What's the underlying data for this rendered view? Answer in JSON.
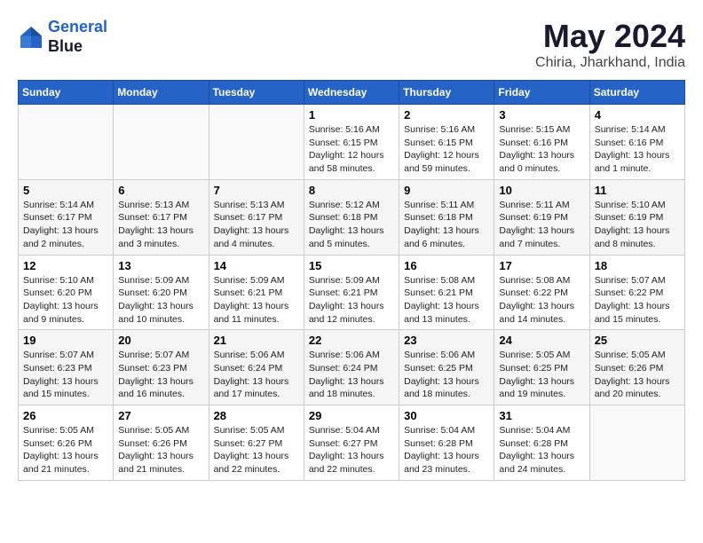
{
  "header": {
    "logo_line1": "General",
    "logo_line2": "Blue",
    "title": "May 2024",
    "subtitle": "Chiria, Jharkhand, India"
  },
  "weekdays": [
    "Sunday",
    "Monday",
    "Tuesday",
    "Wednesday",
    "Thursday",
    "Friday",
    "Saturday"
  ],
  "weeks": [
    [
      {
        "day": "",
        "info": ""
      },
      {
        "day": "",
        "info": ""
      },
      {
        "day": "",
        "info": ""
      },
      {
        "day": "1",
        "info": "Sunrise: 5:16 AM\nSunset: 6:15 PM\nDaylight: 12 hours and 58 minutes."
      },
      {
        "day": "2",
        "info": "Sunrise: 5:16 AM\nSunset: 6:15 PM\nDaylight: 12 hours and 59 minutes."
      },
      {
        "day": "3",
        "info": "Sunrise: 5:15 AM\nSunset: 6:16 PM\nDaylight: 13 hours and 0 minutes."
      },
      {
        "day": "4",
        "info": "Sunrise: 5:14 AM\nSunset: 6:16 PM\nDaylight: 13 hours and 1 minute."
      }
    ],
    [
      {
        "day": "5",
        "info": "Sunrise: 5:14 AM\nSunset: 6:17 PM\nDaylight: 13 hours and 2 minutes."
      },
      {
        "day": "6",
        "info": "Sunrise: 5:13 AM\nSunset: 6:17 PM\nDaylight: 13 hours and 3 minutes."
      },
      {
        "day": "7",
        "info": "Sunrise: 5:13 AM\nSunset: 6:17 PM\nDaylight: 13 hours and 4 minutes."
      },
      {
        "day": "8",
        "info": "Sunrise: 5:12 AM\nSunset: 6:18 PM\nDaylight: 13 hours and 5 minutes."
      },
      {
        "day": "9",
        "info": "Sunrise: 5:11 AM\nSunset: 6:18 PM\nDaylight: 13 hours and 6 minutes."
      },
      {
        "day": "10",
        "info": "Sunrise: 5:11 AM\nSunset: 6:19 PM\nDaylight: 13 hours and 7 minutes."
      },
      {
        "day": "11",
        "info": "Sunrise: 5:10 AM\nSunset: 6:19 PM\nDaylight: 13 hours and 8 minutes."
      }
    ],
    [
      {
        "day": "12",
        "info": "Sunrise: 5:10 AM\nSunset: 6:20 PM\nDaylight: 13 hours and 9 minutes."
      },
      {
        "day": "13",
        "info": "Sunrise: 5:09 AM\nSunset: 6:20 PM\nDaylight: 13 hours and 10 minutes."
      },
      {
        "day": "14",
        "info": "Sunrise: 5:09 AM\nSunset: 6:21 PM\nDaylight: 13 hours and 11 minutes."
      },
      {
        "day": "15",
        "info": "Sunrise: 5:09 AM\nSunset: 6:21 PM\nDaylight: 13 hours and 12 minutes."
      },
      {
        "day": "16",
        "info": "Sunrise: 5:08 AM\nSunset: 6:21 PM\nDaylight: 13 hours and 13 minutes."
      },
      {
        "day": "17",
        "info": "Sunrise: 5:08 AM\nSunset: 6:22 PM\nDaylight: 13 hours and 14 minutes."
      },
      {
        "day": "18",
        "info": "Sunrise: 5:07 AM\nSunset: 6:22 PM\nDaylight: 13 hours and 15 minutes."
      }
    ],
    [
      {
        "day": "19",
        "info": "Sunrise: 5:07 AM\nSunset: 6:23 PM\nDaylight: 13 hours and 15 minutes."
      },
      {
        "day": "20",
        "info": "Sunrise: 5:07 AM\nSunset: 6:23 PM\nDaylight: 13 hours and 16 minutes."
      },
      {
        "day": "21",
        "info": "Sunrise: 5:06 AM\nSunset: 6:24 PM\nDaylight: 13 hours and 17 minutes."
      },
      {
        "day": "22",
        "info": "Sunrise: 5:06 AM\nSunset: 6:24 PM\nDaylight: 13 hours and 18 minutes."
      },
      {
        "day": "23",
        "info": "Sunrise: 5:06 AM\nSunset: 6:25 PM\nDaylight: 13 hours and 18 minutes."
      },
      {
        "day": "24",
        "info": "Sunrise: 5:05 AM\nSunset: 6:25 PM\nDaylight: 13 hours and 19 minutes."
      },
      {
        "day": "25",
        "info": "Sunrise: 5:05 AM\nSunset: 6:26 PM\nDaylight: 13 hours and 20 minutes."
      }
    ],
    [
      {
        "day": "26",
        "info": "Sunrise: 5:05 AM\nSunset: 6:26 PM\nDaylight: 13 hours and 21 minutes."
      },
      {
        "day": "27",
        "info": "Sunrise: 5:05 AM\nSunset: 6:26 PM\nDaylight: 13 hours and 21 minutes."
      },
      {
        "day": "28",
        "info": "Sunrise: 5:05 AM\nSunset: 6:27 PM\nDaylight: 13 hours and 22 minutes."
      },
      {
        "day": "29",
        "info": "Sunrise: 5:04 AM\nSunset: 6:27 PM\nDaylight: 13 hours and 22 minutes."
      },
      {
        "day": "30",
        "info": "Sunrise: 5:04 AM\nSunset: 6:28 PM\nDaylight: 13 hours and 23 minutes."
      },
      {
        "day": "31",
        "info": "Sunrise: 5:04 AM\nSunset: 6:28 PM\nDaylight: 13 hours and 24 minutes."
      },
      {
        "day": "",
        "info": ""
      }
    ]
  ]
}
